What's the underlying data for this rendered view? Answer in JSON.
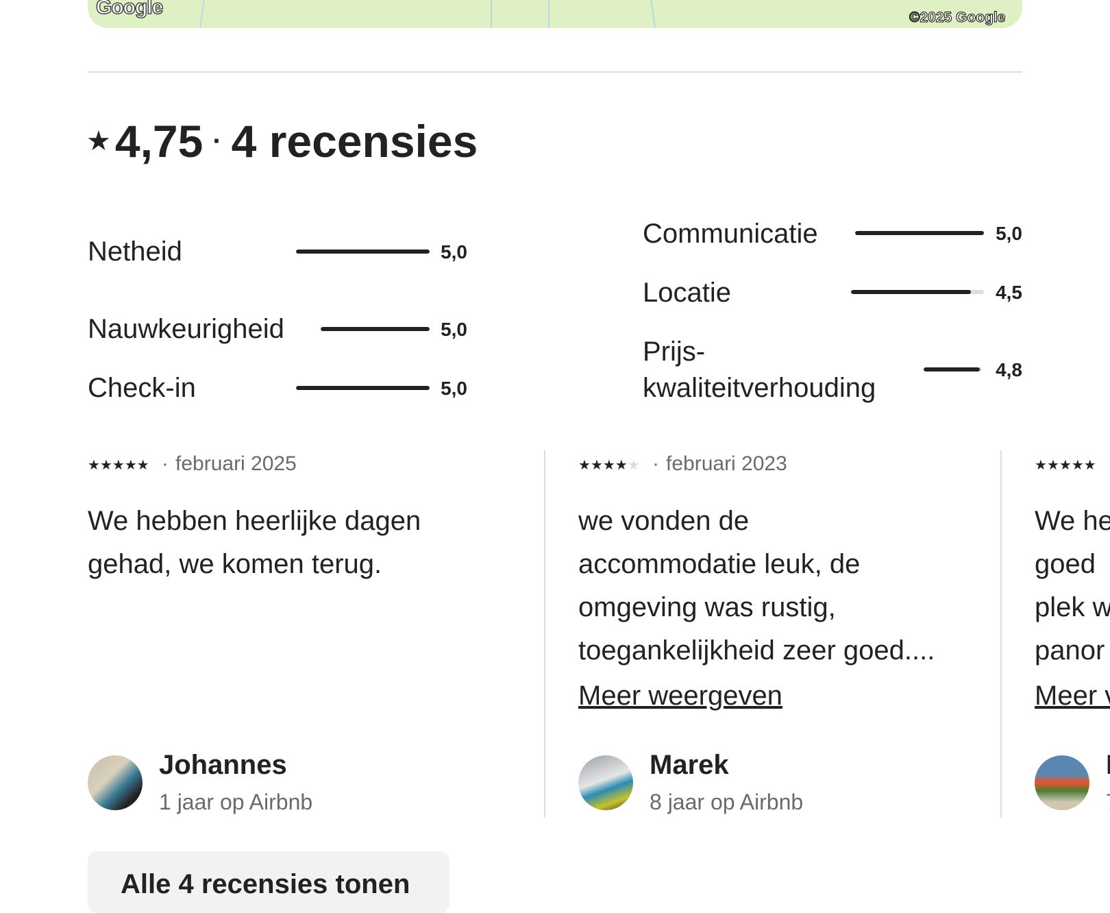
{
  "map": {
    "logo_text": "Google",
    "copyright": "©2025 Google"
  },
  "summary": {
    "star_icon": "star",
    "rating": "4,75",
    "separator": "·",
    "count_label": "4 recensies"
  },
  "categories": [
    {
      "label": "Netheid",
      "value": "5,0",
      "score": 5.0
    },
    {
      "label": "Nauwkeurigheid",
      "value": "5,0",
      "score": 5.0
    },
    {
      "label": "Check-in",
      "value": "5,0",
      "score": 5.0
    },
    {
      "label": "Communicatie",
      "value": "5,0",
      "score": 5.0
    },
    {
      "label": "Locatie",
      "value": "4,5",
      "score": 4.5
    },
    {
      "label": "Prijs-",
      "label2": "kwaliteitverhouding",
      "value": "4,8",
      "score": 4.8
    }
  ],
  "reviews": [
    {
      "stars": 5,
      "date": "februari 2025",
      "lines": [
        "We hebben heerlijke dagen",
        "gehad, we komen terug."
      ],
      "more": "",
      "name": "Johannes",
      "since": "1 jaar op Airbnb"
    },
    {
      "stars": 4,
      "date": "februari 2023",
      "lines": [
        "we vonden de",
        "accommodatie leuk, de",
        "omgeving was rustig,",
        "toegankelijkheid zeer goed...."
      ],
      "more": "Meer weergeven",
      "name": "Marek",
      "since": "8 jaar op Airbnb"
    },
    {
      "stars": 5,
      "date": "",
      "lines": [
        "We he",
        "goed",
        "plek w",
        "panor"
      ],
      "more": "Meer v",
      "name": "I",
      "since": "7"
    }
  ],
  "all_reviews_button": "Alle 4 recensies tonen"
}
